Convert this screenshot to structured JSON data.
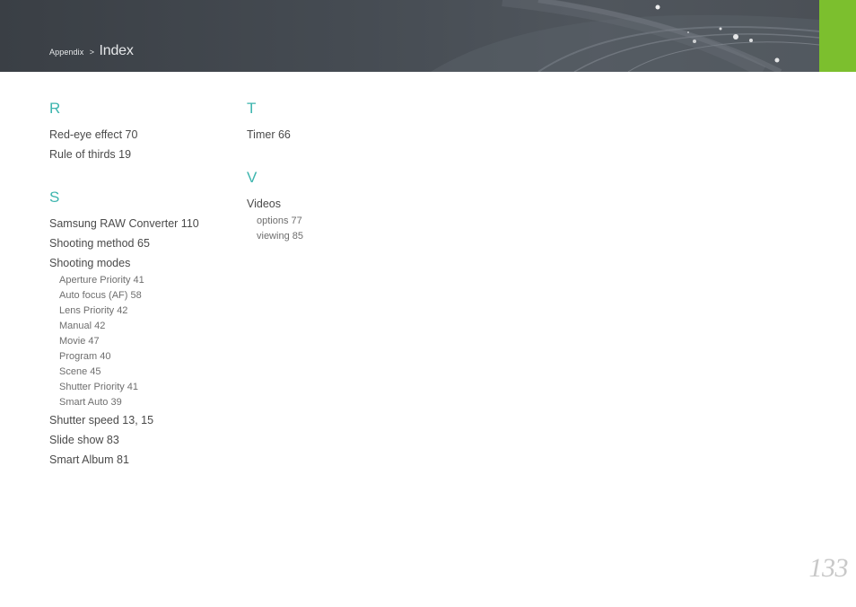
{
  "header": {
    "breadcrumb_parent": "Appendix",
    "breadcrumb_separator": ">",
    "breadcrumb_current": "Index"
  },
  "columns": [
    {
      "sections": [
        {
          "letter": "R",
          "entries": [
            {
              "text": "Red-eye effect  70",
              "subs": []
            },
            {
              "text": "Rule of thirds  19",
              "subs": []
            }
          ]
        },
        {
          "letter": "S",
          "entries": [
            {
              "text": "Samsung RAW Converter  110",
              "subs": []
            },
            {
              "text": "Shooting method  65",
              "subs": []
            },
            {
              "text": "Shooting modes",
              "subs": [
                "Aperture Priority  41",
                "Auto focus (AF)  58",
                "Lens Priority  42",
                "Manual  42",
                "Movie  47",
                "Program  40",
                "Scene  45",
                "Shutter Priority  41",
                "Smart Auto  39"
              ]
            },
            {
              "text": "Shutter speed  13, 15",
              "subs": []
            },
            {
              "text": "Slide show  83",
              "subs": []
            },
            {
              "text": "Smart Album  81",
              "subs": []
            }
          ]
        }
      ]
    },
    {
      "sections": [
        {
          "letter": "T",
          "entries": [
            {
              "text": "Timer  66",
              "subs": []
            }
          ]
        },
        {
          "letter": "V",
          "entries": [
            {
              "text": "Videos",
              "subs": [
                "options  77",
                "viewing  85"
              ]
            }
          ]
        }
      ]
    }
  ],
  "page_number": "133",
  "colors": {
    "header_bg": "#454b52",
    "accent_green": "#7cbf2e",
    "letter_teal": "#3db5ae",
    "text": "#4a4a4a",
    "page_number": "#c8c8c8"
  }
}
